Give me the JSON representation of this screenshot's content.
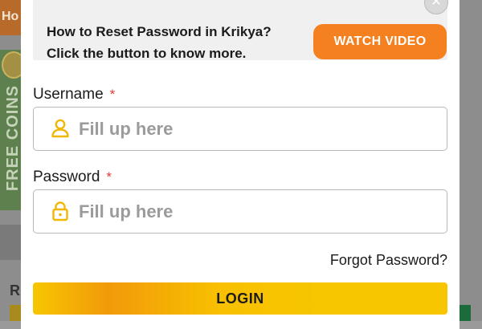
{
  "background": {
    "nav_text": "Ho",
    "banner_text": "FREE COINS",
    "bottom_letter": "R",
    "close_glyph": "✕"
  },
  "info": {
    "line1": "How to Reset Password in Krikya?",
    "line2": "Click the button to know more.",
    "watch_label": "WATCH VIDEO"
  },
  "form": {
    "username": {
      "label": "Username",
      "required": "*",
      "placeholder": "Fill up here",
      "icon": "user-icon"
    },
    "password": {
      "label": "Password",
      "required": "*",
      "placeholder": "Fill up here",
      "icon": "lock-icon"
    },
    "forgot_label": "Forgot Password?",
    "login_label": "LOGIN"
  },
  "colors": {
    "accent_orange": "#f5801f",
    "login_yellow": "#f7c600",
    "required_red": "#e53935",
    "icon_yellow": "#f2b705"
  }
}
